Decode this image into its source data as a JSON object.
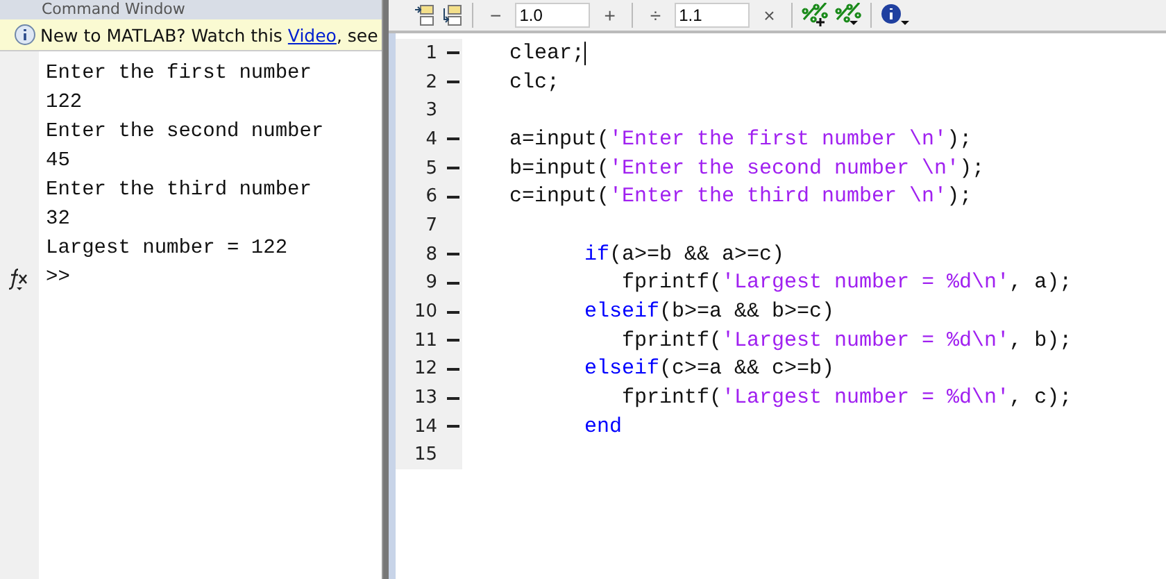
{
  "command_window": {
    "title": "Command Window",
    "info_bar": {
      "before": "New to MATLAB? Watch this ",
      "link": "Video",
      "after": ", see"
    },
    "output": [
      "Enter the first number",
      "122",
      "Enter the second number",
      "45",
      "Enter the third number",
      "32",
      "Largest number = 122"
    ],
    "prompt": ">>"
  },
  "toolbar": {
    "items": [
      {
        "kind": "insert"
      },
      {
        "kind": "insertbreak"
      },
      {
        "kind": "sep"
      },
      {
        "kind": "button",
        "label": "−"
      },
      {
        "kind": "field",
        "value": "1.0"
      },
      {
        "kind": "button",
        "label": "+"
      },
      {
        "kind": "sep"
      },
      {
        "kind": "button",
        "label": "÷"
      },
      {
        "kind": "field",
        "value": "1.1"
      },
      {
        "kind": "button",
        "label": "×"
      },
      {
        "kind": "sep"
      },
      {
        "kind": "percentplus"
      },
      {
        "kind": "percentmenu"
      },
      {
        "kind": "sep"
      },
      {
        "kind": "infomenu"
      }
    ]
  },
  "editor": {
    "lines": [
      {
        "number": "1",
        "breakpoint": true,
        "cursor": true,
        "tokens": [
          {
            "kind": "plain",
            "text": "clear;"
          }
        ]
      },
      {
        "number": "2",
        "breakpoint": true,
        "tokens": [
          {
            "kind": "plain",
            "text": "clc;"
          }
        ]
      },
      {
        "number": "3",
        "breakpoint": false
      },
      {
        "number": "4",
        "breakpoint": true,
        "tokens": [
          {
            "kind": "plain",
            "text": "a=input("
          },
          {
            "kind": "string",
            "text": "'Enter the first number \\n'"
          },
          {
            "kind": "plain",
            "text": ");"
          }
        ]
      },
      {
        "number": "5",
        "breakpoint": true,
        "tokens": [
          {
            "kind": "plain",
            "text": "b=input("
          },
          {
            "kind": "string",
            "text": "'Enter the second number \\n'"
          },
          {
            "kind": "plain",
            "text": ");"
          }
        ]
      },
      {
        "number": "6",
        "breakpoint": true,
        "tokens": [
          {
            "kind": "plain",
            "text": "c=input("
          },
          {
            "kind": "string",
            "text": "'Enter the third number \\n'"
          },
          {
            "kind": "plain",
            "text": ");"
          }
        ]
      },
      {
        "number": "7",
        "breakpoint": false
      },
      {
        "number": "8",
        "breakpoint": true,
        "tokens": [
          {
            "kind": "keyword",
            "text": "      if"
          },
          {
            "kind": "plain",
            "text": "(a>=b && a>=c)"
          }
        ]
      },
      {
        "number": "9",
        "breakpoint": true,
        "tokens": [
          {
            "kind": "plain",
            "text": "         fprintf("
          },
          {
            "kind": "string",
            "text": "'Largest number = %d\\n'"
          },
          {
            "kind": "plain",
            "text": ", a);"
          }
        ]
      },
      {
        "number": "10",
        "breakpoint": true,
        "tokens": [
          {
            "kind": "keyword",
            "text": "      elseif"
          },
          {
            "kind": "plain",
            "text": "(b>=a && b>=c)"
          }
        ]
      },
      {
        "number": "11",
        "breakpoint": true,
        "tokens": [
          {
            "kind": "plain",
            "text": "         fprintf("
          },
          {
            "kind": "string",
            "text": "'Largest number = %d\\n'"
          },
          {
            "kind": "plain",
            "text": ", b);"
          }
        ]
      },
      {
        "number": "12",
        "breakpoint": true,
        "tokens": [
          {
            "kind": "keyword",
            "text": "      elseif"
          },
          {
            "kind": "plain",
            "text": "(c>=a && c>=b)"
          }
        ]
      },
      {
        "number": "13",
        "breakpoint": true,
        "tokens": [
          {
            "kind": "plain",
            "text": "         fprintf("
          },
          {
            "kind": "string",
            "text": "'Largest number = %d\\n'"
          },
          {
            "kind": "plain",
            "text": ", c);"
          }
        ]
      },
      {
        "number": "14",
        "breakpoint": true,
        "tokens": [
          {
            "kind": "keyword",
            "text": "      end"
          }
        ]
      },
      {
        "number": "15",
        "breakpoint": false
      }
    ]
  }
}
